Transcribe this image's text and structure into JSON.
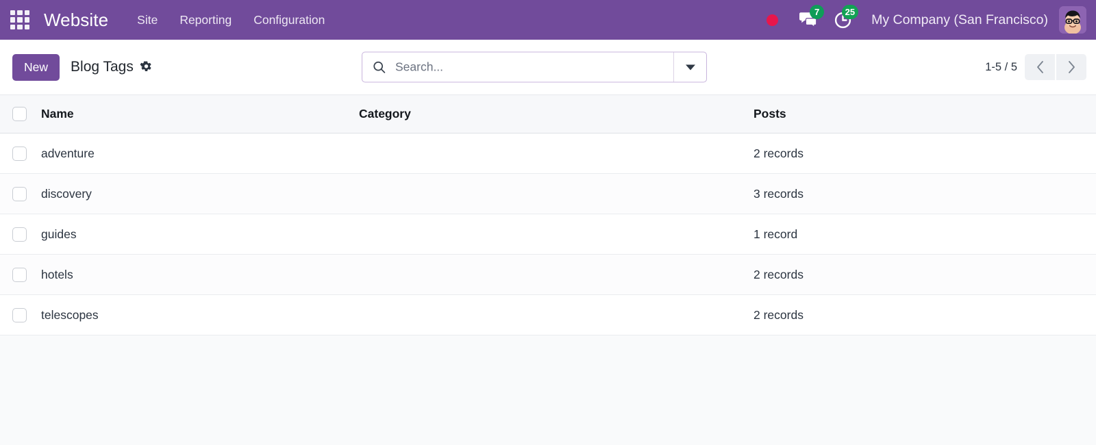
{
  "navbar": {
    "apps_icon": "apps-grid-icon",
    "brand": "Website",
    "menus": [
      {
        "label": "Site"
      },
      {
        "label": "Reporting"
      },
      {
        "label": "Configuration"
      }
    ],
    "recording_indicator": "record-dot-icon",
    "messaging": {
      "icon": "chat-bubbles-icon",
      "count": "7"
    },
    "activities": {
      "icon": "clock-icon",
      "count": "25"
    },
    "company": "My Company (San Francisco)",
    "avatar": "user-avatar"
  },
  "control_panel": {
    "new_label": "New",
    "page_title": "Blog Tags",
    "gear_icon": "gear-icon",
    "search": {
      "icon": "search-icon",
      "value": "",
      "placeholder": "Search...",
      "toggle_icon": "chevron-down-icon"
    },
    "pager": {
      "counter": "1-5 / 5",
      "previous_icon": "chevron-left-icon",
      "next_icon": "chevron-right-icon"
    }
  },
  "list": {
    "columns": [
      {
        "label": "Name"
      },
      {
        "label": "Category"
      },
      {
        "label": "Posts"
      }
    ],
    "rows": [
      {
        "name": "adventure",
        "category": "",
        "posts": "2 records"
      },
      {
        "name": "discovery",
        "category": "",
        "posts": "3 records"
      },
      {
        "name": "guides",
        "category": "",
        "posts": "1 record"
      },
      {
        "name": "hotels",
        "category": "",
        "posts": "2 records"
      },
      {
        "name": "telescopes",
        "category": "",
        "posts": "2 records"
      }
    ]
  },
  "colors": {
    "brand_purple": "#714B9B",
    "badge_green": "#0F9D58",
    "record_red": "#E8164B",
    "search_border": "#C8B4DC",
    "page_bg": "#F9FAFB"
  }
}
